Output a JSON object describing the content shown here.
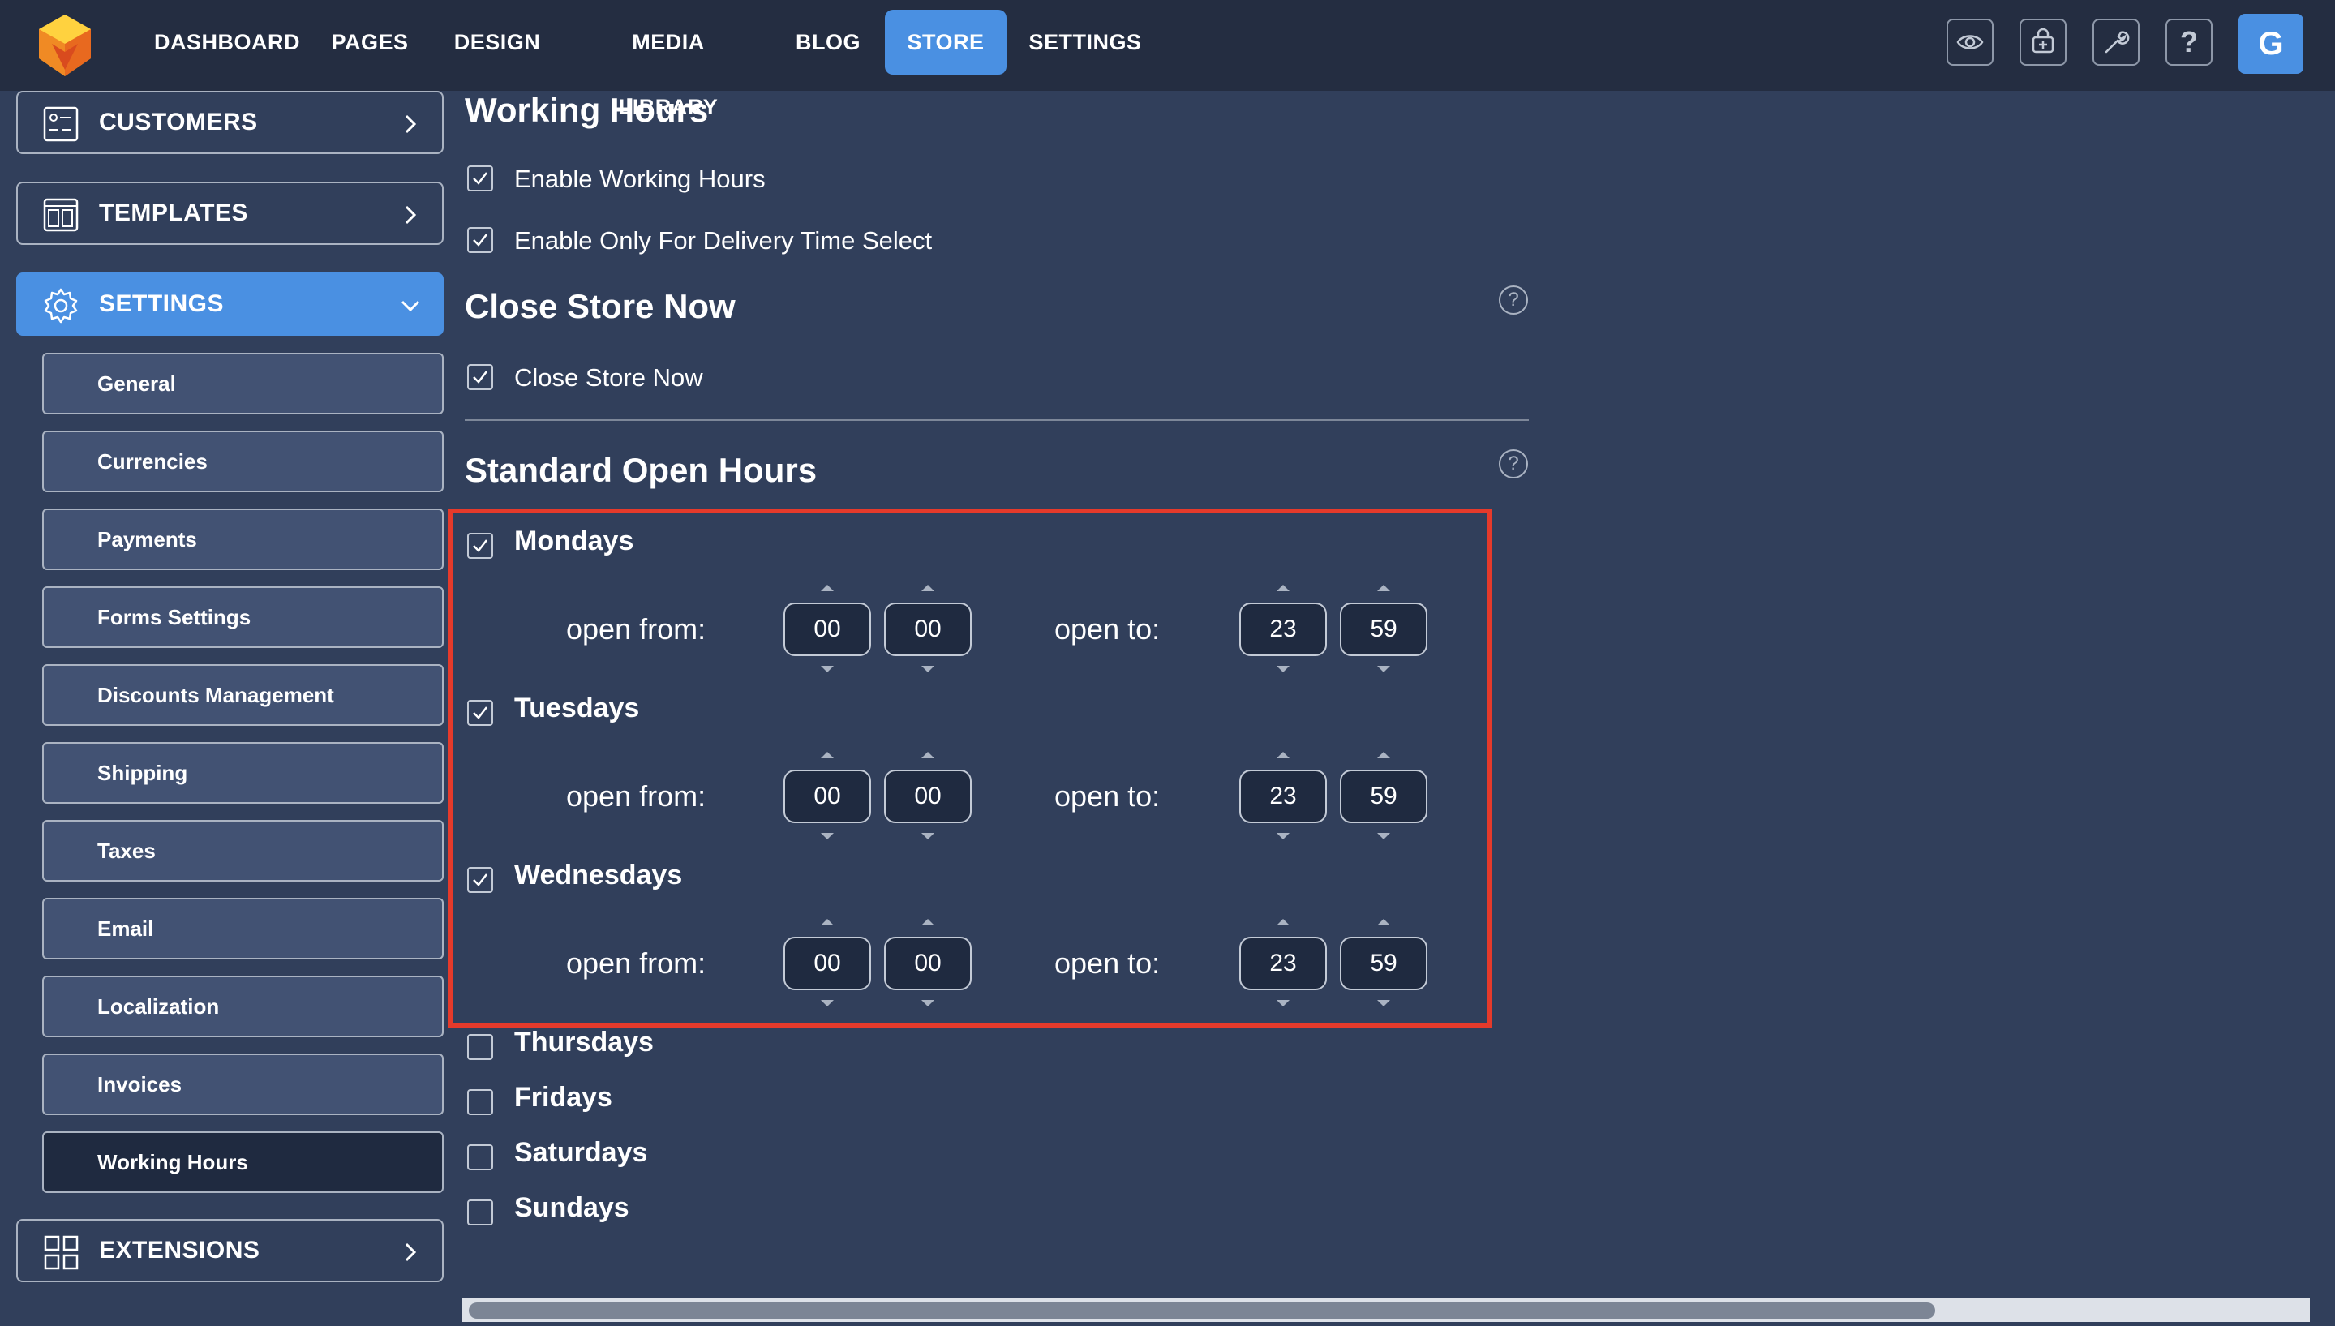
{
  "nav": {
    "items": [
      "DASHBOARD",
      "PAGES",
      "DESIGN",
      "MEDIA LIBRARY",
      "BLOG",
      "STORE",
      "SETTINGS"
    ],
    "active": "STORE",
    "avatar_letter": "G",
    "tools": [
      "eye-icon",
      "basket-add-icon",
      "wrench-icon",
      "question-icon"
    ]
  },
  "sidebar": {
    "customers": "CUSTOMERS",
    "templates": "TEMPLATES",
    "settings": "SETTINGS",
    "sub_items": [
      "General",
      "Currencies",
      "Payments",
      "Forms Settings",
      "Discounts Management",
      "Shipping",
      "Taxes",
      "Email",
      "Localization",
      "Invoices",
      "Working Hours"
    ],
    "active_sub": "Working Hours",
    "extensions": "EXTENSIONS"
  },
  "working_hours": {
    "title": "Working Hours",
    "enable_label": "Enable Working Hours",
    "delivery_label": "Enable Only For Delivery Time Select"
  },
  "close_store": {
    "title": "Close Store Now",
    "checkbox_label": "Close Store Now"
  },
  "standard_hours": {
    "title": "Standard Open Hours",
    "open_from_label": "open from:",
    "open_to_label": "open to:",
    "days": [
      {
        "name": "Mondays",
        "checked": true,
        "from_h": "00",
        "from_m": "00",
        "to_h": "23",
        "to_m": "59"
      },
      {
        "name": "Tuesdays",
        "checked": true,
        "from_h": "00",
        "from_m": "00",
        "to_h": "23",
        "to_m": "59"
      },
      {
        "name": "Wednesdays",
        "checked": true,
        "from_h": "00",
        "from_m": "00",
        "to_h": "23",
        "to_m": "59"
      },
      {
        "name": "Thursdays",
        "checked": false
      },
      {
        "name": "Fridays",
        "checked": false
      },
      {
        "name": "Saturdays",
        "checked": false
      },
      {
        "name": "Sundays",
        "checked": false
      }
    ]
  },
  "colors": {
    "accent": "#4a90e2",
    "highlight": "#e53a2b",
    "background": "#313f5b",
    "topbar": "#242d41"
  }
}
